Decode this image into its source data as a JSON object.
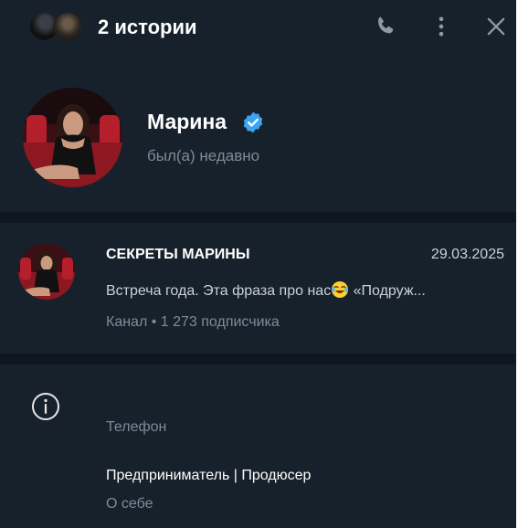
{
  "header": {
    "title": "2 истории"
  },
  "profile": {
    "name": "Марина",
    "status": "был(а) недавно"
  },
  "channel": {
    "title": "СЕКРЕТЫ МАРИНЫ",
    "date": "29.03.2025",
    "preview_start": "Встреча года. Эта фраза про нас",
    "preview_emoji": "laughing-crying-emoji",
    "preview_end": " «Подруж...",
    "meta": "Канал • 1 273 подписчика"
  },
  "info": {
    "phone_label": "Телефон",
    "about_value": "Предприниматель | Продюсер",
    "about_label": "О себе"
  },
  "colors": {
    "background": "#17212b",
    "divider": "#0e1621",
    "secondary_text": "#7d8b99",
    "verified_badge": "#3aa5f5"
  },
  "icons": [
    "phone-icon",
    "more-vertical-icon",
    "close-icon",
    "verified-badge-icon",
    "info-icon"
  ]
}
